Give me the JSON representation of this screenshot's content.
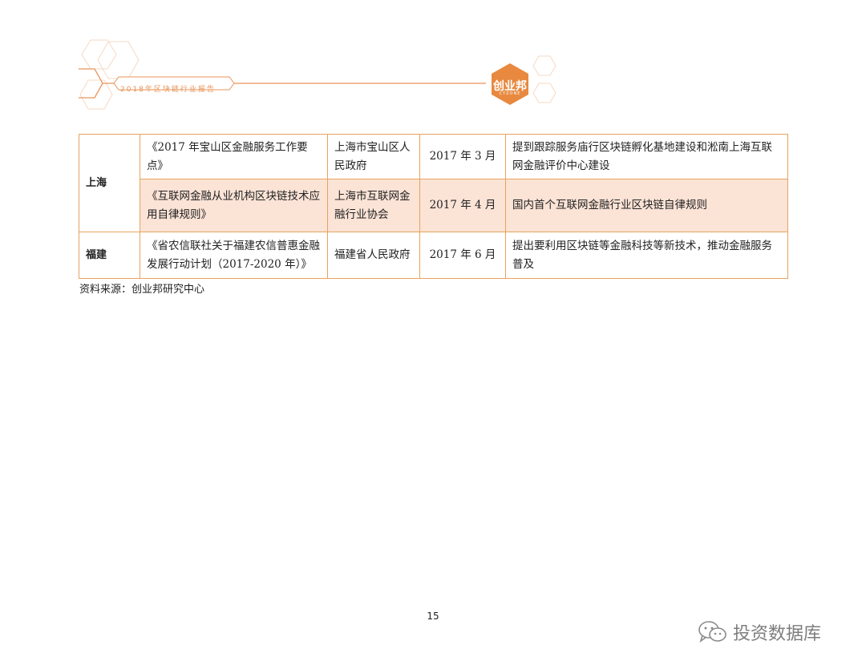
{
  "header": {
    "report_label": "2018年区块链行业报告",
    "logo_text": "创业邦",
    "logo_subtext": "CYZONE",
    "accent_color": "#e8955a"
  },
  "table": {
    "rows": [
      {
        "region": "上海",
        "document": "《2017 年宝山区金融服务工作要点》",
        "issuer": "上海市宝山区人民政府",
        "date_year": "2017",
        "date_rest": "年 3 月",
        "content": "提到跟踪服务庙行区块链孵化基地建设和淞南上海互联网金融评价中心建设"
      },
      {
        "region": "",
        "document": "《互联网金融从业机构区块链技术应用自律规则》",
        "issuer": "上海市互联网金融行业协会",
        "date_year": "2017",
        "date_rest": "年 4 月",
        "content": "国内首个互联网金融行业区块链自律规则"
      },
      {
        "region": "福建",
        "document": "《省农信联社关于福建农信普惠金融发展行动计划（2017-2020 年）》",
        "issuer": "福建省人民政府",
        "date_year": "2017",
        "date_rest": "年 6 月",
        "content": "提出要利用区块链等金融科技等新技术，推动金融服务普及"
      }
    ],
    "border_color": "#e8a35e",
    "shade_color": "#fbe3d6"
  },
  "source_note": "资料来源：创业邦研究中心",
  "page_number": "15",
  "watermark": "投资数据库"
}
